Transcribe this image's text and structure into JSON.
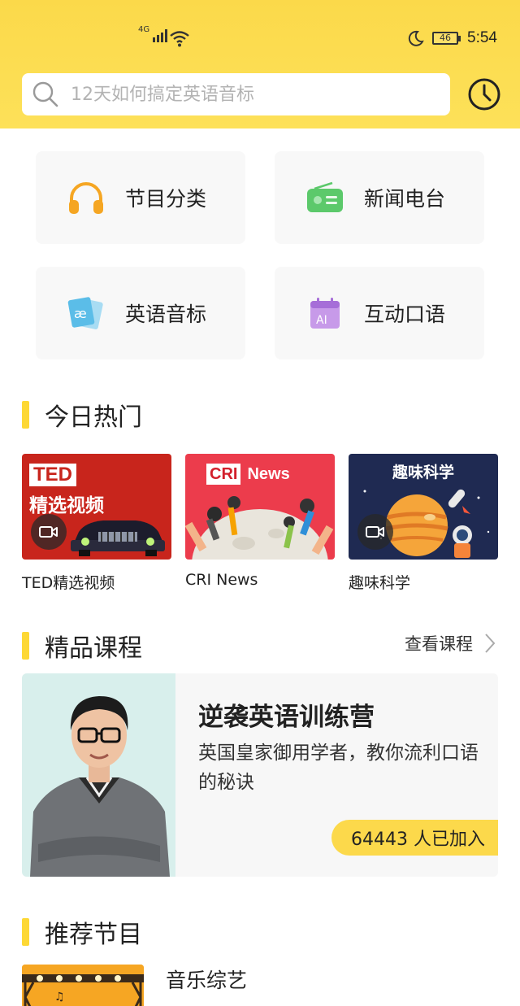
{
  "status_bar": {
    "network": "4G",
    "battery": "46",
    "time": "5:54"
  },
  "search": {
    "placeholder": "12天如何搞定英语音标"
  },
  "categories": [
    {
      "label": "节目分类",
      "icon": "headphones-icon",
      "color": "#f5a623"
    },
    {
      "label": "新闻电台",
      "icon": "radio-icon",
      "color": "#5cc96b"
    },
    {
      "label": "英语音标",
      "icon": "phonetic-card-icon",
      "color": "#5bbde8"
    },
    {
      "label": "互动口语",
      "icon": "ai-calendar-icon",
      "color": "#b57be0"
    }
  ],
  "hot_section": {
    "title": "今日热门",
    "items": [
      {
        "caption": "TED精选视频",
        "thumb_title_1": "TED",
        "thumb_title_2": "精选视频",
        "has_video": true
      },
      {
        "caption": "CRI News",
        "thumb_title_1": "CRI",
        "thumb_title_2": "News",
        "has_video": false
      },
      {
        "caption": "趣味科学",
        "thumb_title_1": "趣味科学",
        "has_video": true
      }
    ]
  },
  "course_section": {
    "title": "精品课程",
    "more_label": "查看课程",
    "course": {
      "title": "逆袭英语训练营",
      "desc": "英国皇家御用学者，教你流利口语的秘诀",
      "joined": "64443 人已加入"
    }
  },
  "recommend_section": {
    "title": "推荐节目",
    "item": {
      "title": "音乐综艺"
    }
  },
  "colors": {
    "header": "#fdd94a",
    "accent": "#fdd835"
  }
}
